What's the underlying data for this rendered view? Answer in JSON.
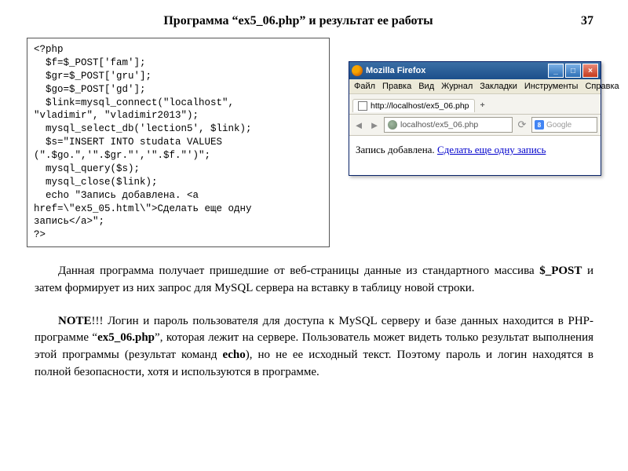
{
  "header": {
    "title": "Программа “ex5_06.php” и  результат  ее  работы",
    "page_num": "37"
  },
  "code": "<?php\n  $f=$_POST['fam'];\n  $gr=$_POST['gru'];\n  $go=$_POST['gd'];\n  $link=mysql_connect(\"localhost\",\n\"vladimir\", \"vladimir2013\");\n  mysql_select_db('lection5', $link);\n  $s=\"INSERT INTO studata VALUES\n(\".$go.\",'\".$gr.\"','\".$f.\"')\";\n  mysql_query($s);\n  mysql_close($link);\n  echo \"Запись добавлена. <a\nhref=\\\"ex5_05.html\\\">Сделать еще одну\nзапись</a>\";\n?>",
  "browser": {
    "title": "Mozilla Firefox",
    "menu": [
      "Файл",
      "Правка",
      "Вид",
      "Журнал",
      "Закладки",
      "Инструменты",
      "Справка"
    ],
    "tab_label": "http://localhost/ex5_06.php",
    "url": "localhost/ex5_06.php",
    "search_placeholder": "Google",
    "content_text": "Запись добавлена. ",
    "content_link": "Сделать еще одну запись"
  },
  "paragraph1_parts": [
    "Данная   программа   получает   пришедшие   от   веб-страницы   данные   из стандартного  массива  ",
    "$_POST",
    "  и  затем  формирует  из   них    запрос    для MySQL сервера  на  вставку  в  таблицу новой строки."
  ],
  "paragraph2_parts": [
    "NOTE",
    "!!!  Логин  и  пароль  пользователя для  доступа  к MySQL серверу  и  базе данных    находится    в   PHP-программе   “",
    "ex5_06.php",
    "”,   которая   лежит   на   сервере. Пользователь   может   видеть   только   результат   выполнения этой   программы  (результат  команд  ",
    "echo",
    "),   но   не   ее исходный  текст.  Поэтому  пароль  и  логин находятся  в полной безопасности, хотя и используются в программе."
  ]
}
